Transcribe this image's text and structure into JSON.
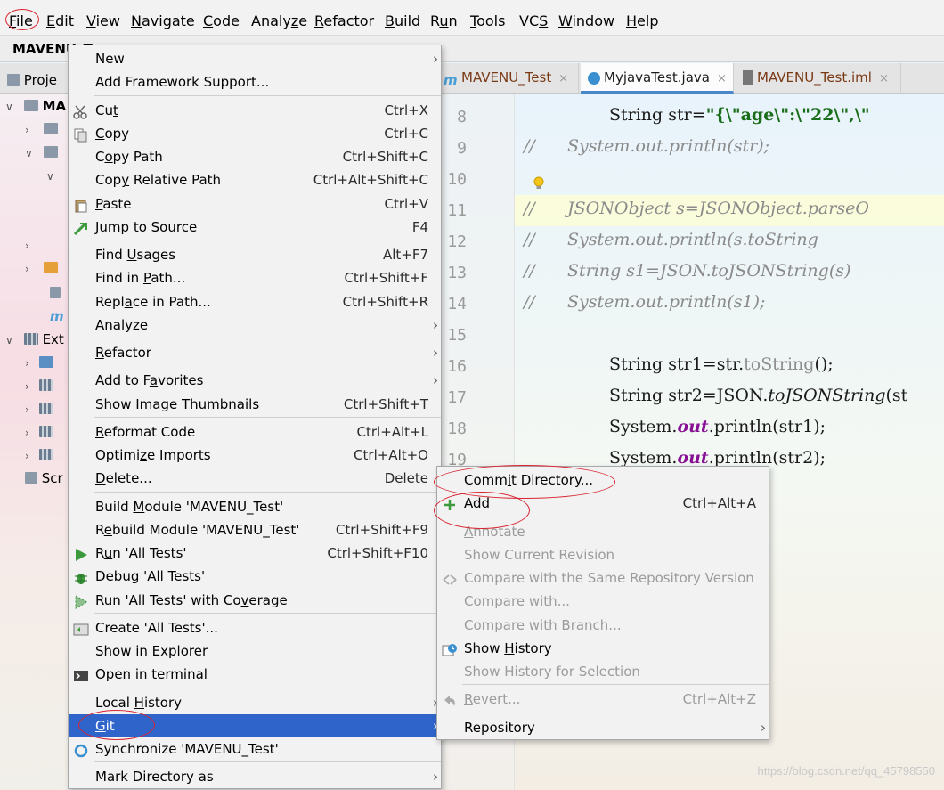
{
  "menubar": {
    "items": [
      {
        "pre": "",
        "ul": "F",
        "post": "ile"
      },
      {
        "pre": "",
        "ul": "E",
        "post": "dit"
      },
      {
        "pre": "",
        "ul": "V",
        "post": "iew"
      },
      {
        "pre": "",
        "ul": "N",
        "post": "avigate"
      },
      {
        "pre": "",
        "ul": "C",
        "post": "ode"
      },
      {
        "pre": "Analy",
        "ul": "z",
        "post": "e"
      },
      {
        "pre": "",
        "ul": "R",
        "post": "efactor"
      },
      {
        "pre": "",
        "ul": "B",
        "post": "uild"
      },
      {
        "pre": "R",
        "ul": "u",
        "post": "n"
      },
      {
        "pre": "",
        "ul": "T",
        "post": "ools"
      },
      {
        "pre": "VC",
        "ul": "S",
        "post": ""
      },
      {
        "pre": "",
        "ul": "W",
        "post": "indow"
      },
      {
        "pre": "",
        "ul": "H",
        "post": "elp"
      }
    ]
  },
  "navbar": {
    "crumb": "MAVENU_T"
  },
  "tabs": [
    {
      "label": "MAVENU_Test",
      "close": "×",
      "icon": "maven-icon"
    },
    {
      "label": "MyjavaTest.java",
      "close": "×",
      "icon": "java-class-icon"
    },
    {
      "label": "MAVENU_Test.iml",
      "close": "×",
      "icon": "iml-file-icon"
    }
  ],
  "project_panel": {
    "tab_label": "Proje",
    "root": "MA",
    "external": "Ext",
    "scratches": "Scr"
  },
  "editor": {
    "line_numbers": [
      "8",
      "9",
      "10",
      "11",
      "12",
      "13",
      "14",
      "15",
      "16",
      "17",
      "18",
      "19"
    ],
    "lines": {
      "l8a": "String str=",
      "l8b": "\"{\\\"age\\\":\\\"22\\\",\\\"",
      "l9": "//      System.out.println(str);",
      "l11": "//      JSONObject s=JSONObject.parseO",
      "l12": "//      System.out.println(s.toString",
      "l13": "//      String s1=JSON.toJSONString(s)",
      "l14": "//      System.out.println(s1);",
      "l16a": "String str1=str.",
      "l16b": "toString",
      "l16c": "();",
      "l17a": "String str2=JSON.",
      "l17b": "toJSONString",
      "l17c": "(st",
      "l18a": "System.",
      "l18b": "out",
      "l18c": ".println(str1);",
      "l19a": "System.",
      "l19b": "out",
      "l19c": ".println(str2);"
    }
  },
  "context_menu": {
    "items": [
      {
        "pre": "New",
        "ul": "",
        "post": "",
        "shortcut": "",
        "submenu": true,
        "icon": ""
      },
      {
        "pre": "Add Framework Support...",
        "ul": "",
        "post": "",
        "shortcut": "",
        "submenu": false,
        "icon": ""
      },
      {
        "pre": "Cu",
        "ul": "t",
        "post": "",
        "shortcut": "Ctrl+X",
        "submenu": false,
        "icon": "scissors-icon"
      },
      {
        "pre": "",
        "ul": "C",
        "post": "opy",
        "shortcut": "Ctrl+C",
        "submenu": false,
        "icon": "copy-icon"
      },
      {
        "pre": "C",
        "ul": "o",
        "post": "py Path",
        "shortcut": "Ctrl+Shift+C",
        "submenu": false,
        "icon": ""
      },
      {
        "pre": "Cop",
        "ul": "y",
        "post": " Relative Path",
        "shortcut": "Ctrl+Alt+Shift+C",
        "submenu": false,
        "icon": ""
      },
      {
        "pre": "",
        "ul": "P",
        "post": "aste",
        "shortcut": "Ctrl+V",
        "submenu": false,
        "icon": "paste-icon"
      },
      {
        "pre": "Jump to Source",
        "ul": "",
        "post": "",
        "shortcut": "F4",
        "submenu": false,
        "icon": "jump-icon"
      },
      {
        "pre": "Find ",
        "ul": "U",
        "post": "sages",
        "shortcut": "Alt+F7",
        "submenu": false,
        "icon": ""
      },
      {
        "pre": "Find in ",
        "ul": "P",
        "post": "ath...",
        "shortcut": "Ctrl+Shift+F",
        "submenu": false,
        "icon": ""
      },
      {
        "pre": "Repl",
        "ul": "a",
        "post": "ce in Path...",
        "shortcut": "Ctrl+Shift+R",
        "submenu": false,
        "icon": ""
      },
      {
        "pre": "Analyze",
        "ul": "",
        "post": "",
        "shortcut": "",
        "submenu": true,
        "icon": ""
      },
      {
        "pre": "",
        "ul": "R",
        "post": "efactor",
        "shortcut": "",
        "submenu": true,
        "icon": ""
      },
      {
        "pre": "Add to F",
        "ul": "a",
        "post": "vorites",
        "shortcut": "",
        "submenu": true,
        "icon": ""
      },
      {
        "pre": "Show Image Thumbnails",
        "ul": "",
        "post": "",
        "shortcut": "Ctrl+Shift+T",
        "submenu": false,
        "icon": ""
      },
      {
        "pre": "",
        "ul": "R",
        "post": "eformat Code",
        "shortcut": "Ctrl+Alt+L",
        "submenu": false,
        "icon": ""
      },
      {
        "pre": "Optimi",
        "ul": "z",
        "post": "e Imports",
        "shortcut": "Ctrl+Alt+O",
        "submenu": false,
        "icon": ""
      },
      {
        "pre": "",
        "ul": "D",
        "post": "elete...",
        "shortcut": "Delete",
        "submenu": false,
        "icon": ""
      },
      {
        "pre": "Build ",
        "ul": "M",
        "post": "odule 'MAVENU_Test'",
        "shortcut": "",
        "submenu": false,
        "icon": ""
      },
      {
        "pre": "R",
        "ul": "e",
        "post": "build Module 'MAVENU_Test'",
        "shortcut": "Ctrl+Shift+F9",
        "submenu": false,
        "icon": ""
      },
      {
        "pre": "R",
        "ul": "u",
        "post": "n 'All Tests'",
        "shortcut": "Ctrl+Shift+F10",
        "submenu": false,
        "icon": "run-icon"
      },
      {
        "pre": "",
        "ul": "D",
        "post": "ebug 'All Tests'",
        "shortcut": "",
        "submenu": false,
        "icon": "debug-icon"
      },
      {
        "pre": "Run 'All Tests' with Co",
        "ul": "v",
        "post": "erage",
        "shortcut": "",
        "submenu": false,
        "icon": "coverage-icon"
      },
      {
        "pre": "Create 'All Tests'...",
        "ul": "",
        "post": "",
        "shortcut": "",
        "submenu": false,
        "icon": "create-test-icon"
      },
      {
        "pre": "Show in Explorer",
        "ul": "",
        "post": "",
        "shortcut": "",
        "submenu": false,
        "icon": ""
      },
      {
        "pre": "Open in terminal",
        "ul": "",
        "post": "",
        "shortcut": "",
        "submenu": false,
        "icon": "terminal-icon"
      },
      {
        "pre": "Local ",
        "ul": "H",
        "post": "istory",
        "shortcut": "",
        "submenu": true,
        "icon": ""
      },
      {
        "pre": "",
        "ul": "G",
        "post": "it",
        "shortcut": "",
        "submenu": true,
        "icon": ""
      },
      {
        "pre": "Synchronize 'MAVENU_Test'",
        "ul": "",
        "post": "",
        "shortcut": "",
        "submenu": false,
        "icon": "sync-icon"
      },
      {
        "pre": "Mark Directory as",
        "ul": "",
        "post": "",
        "shortcut": "",
        "submenu": true,
        "icon": ""
      }
    ]
  },
  "git_submenu": {
    "items": [
      {
        "pre": "Comm",
        "ul": "i",
        "post": "t Directory...",
        "shortcut": "",
        "submenu": false,
        "disabled": false,
        "icon": ""
      },
      {
        "pre": "Add",
        "ul": "",
        "post": "",
        "shortcut": "Ctrl+Alt+A",
        "submenu": false,
        "disabled": false,
        "icon": "plus-icon"
      },
      {
        "pre": "",
        "ul": "A",
        "post": "nnotate",
        "shortcut": "",
        "submenu": false,
        "disabled": true,
        "icon": ""
      },
      {
        "pre": "Show Current Revision",
        "ul": "",
        "post": "",
        "shortcut": "",
        "submenu": false,
        "disabled": true,
        "icon": ""
      },
      {
        "pre": "Compare with the Same Repository Version",
        "ul": "",
        "post": "",
        "shortcut": "",
        "submenu": false,
        "disabled": true,
        "icon": "compare-icon"
      },
      {
        "pre": "",
        "ul": "C",
        "post": "ompare with...",
        "shortcut": "",
        "submenu": false,
        "disabled": true,
        "icon": ""
      },
      {
        "pre": "Compare with Branch...",
        "ul": "",
        "post": "",
        "shortcut": "",
        "submenu": false,
        "disabled": true,
        "icon": ""
      },
      {
        "pre": "Show ",
        "ul": "H",
        "post": "istory",
        "shortcut": "",
        "submenu": false,
        "disabled": false,
        "icon": "history-icon"
      },
      {
        "pre": "Show History for Selection",
        "ul": "",
        "post": "",
        "shortcut": "",
        "submenu": false,
        "disabled": true,
        "icon": ""
      },
      {
        "pre": "",
        "ul": "R",
        "post": "evert...",
        "shortcut": "Ctrl+Alt+Z",
        "submenu": false,
        "disabled": true,
        "icon": "revert-icon"
      },
      {
        "pre": "Repository",
        "ul": "",
        "post": "",
        "shortcut": "",
        "submenu": true,
        "disabled": false,
        "icon": ""
      }
    ]
  },
  "watermark": "https://blog.csdn.net/qq_45798550",
  "colors": {
    "selection": "#2f65ca",
    "annotation": "#d9232f",
    "menu_bg": "#f2f2f2"
  }
}
